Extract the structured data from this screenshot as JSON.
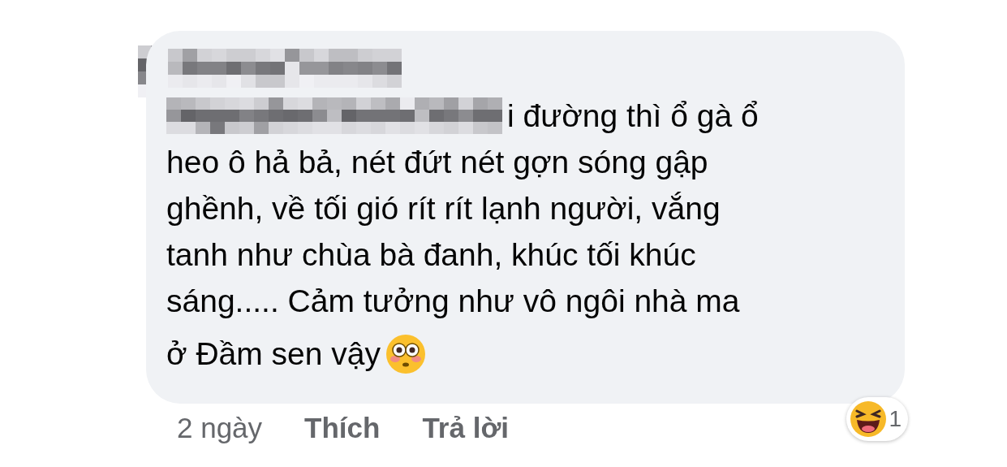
{
  "comment": {
    "first_line": "i đường thì ổ gà ổ",
    "middle_lines": [
      "heo ô hả bả, nét đứt nét gợn sóng gập",
      "ghềnh, về tối gió rít rít lạnh người, vắng",
      "tanh như chùa bà đanh, khúc tối khúc",
      "sáng..... Cảm tưởng như vô ngôi nhà ma"
    ],
    "last_line": "ở Đầm sen vậy"
  },
  "actions": {
    "time": "2 ngày",
    "like": "Thích",
    "reply": "Trả lời"
  },
  "reaction": {
    "count": "1"
  }
}
